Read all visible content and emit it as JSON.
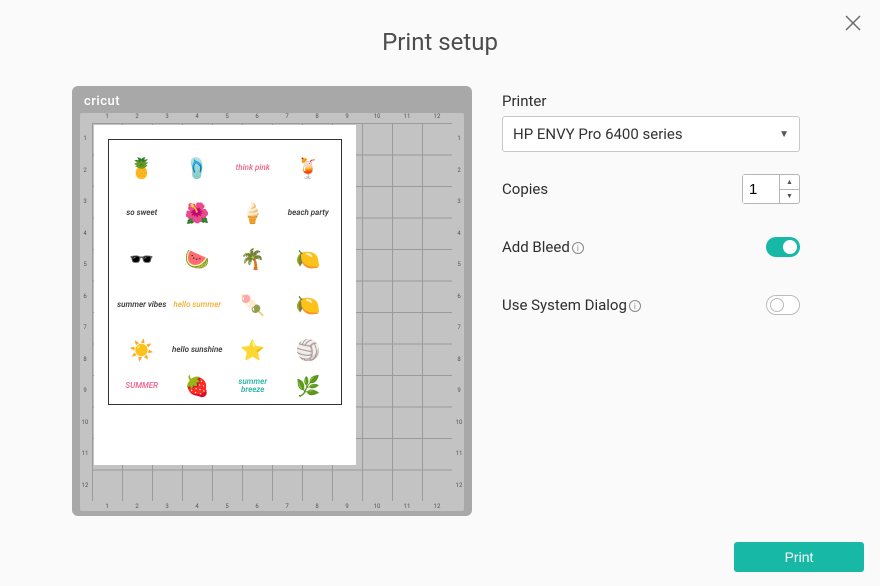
{
  "title": "Print setup",
  "brand": "cricut",
  "mat": {
    "ticks": [
      "1",
      "2",
      "3",
      "4",
      "5",
      "6",
      "7",
      "8",
      "9",
      "10",
      "11",
      "12"
    ]
  },
  "settings": {
    "printer_label": "Printer",
    "printer_value": "HP ENVY Pro 6400 series",
    "copies_label": "Copies",
    "copies_value": "1",
    "bleed_label": "Add Bleed",
    "bleed_on": true,
    "system_label": "Use System Dialog",
    "system_on": false
  },
  "print_label": "Print",
  "stickers": [
    {
      "t": "emoji",
      "v": "🍍"
    },
    {
      "t": "emoji",
      "v": "🩴"
    },
    {
      "t": "text",
      "v": "think pink",
      "cls": "pink"
    },
    {
      "t": "emoji",
      "v": "🍹"
    },
    {
      "t": "text",
      "v": "so sweet",
      "cls": ""
    },
    {
      "t": "emoji",
      "v": "🌺"
    },
    {
      "t": "emoji",
      "v": "🍦"
    },
    {
      "t": "text",
      "v": "beach party",
      "cls": ""
    },
    {
      "t": "emoji",
      "v": "🕶️"
    },
    {
      "t": "emoji",
      "v": "🍉"
    },
    {
      "t": "emoji",
      "v": "🌴"
    },
    {
      "t": "emoji",
      "v": "🍋"
    },
    {
      "t": "text",
      "v": "summer vibes",
      "cls": ""
    },
    {
      "t": "text",
      "v": "hello summer",
      "cls": "yellow"
    },
    {
      "t": "emoji",
      "v": "🍡"
    },
    {
      "t": "emoji",
      "v": "🍋"
    },
    {
      "t": "emoji",
      "v": "☀️"
    },
    {
      "t": "text",
      "v": "hello sunshine",
      "cls": ""
    },
    {
      "t": "emoji",
      "v": "⭐"
    },
    {
      "t": "emoji",
      "v": "🏐"
    },
    {
      "t": "text",
      "v": "SUMMER",
      "cls": "pink"
    },
    {
      "t": "emoji",
      "v": "🍓"
    },
    {
      "t": "text",
      "v": "summer breeze",
      "cls": "teal"
    },
    {
      "t": "emoji",
      "v": "🌿"
    }
  ]
}
